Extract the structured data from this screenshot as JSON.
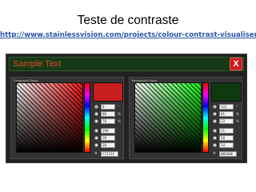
{
  "slide": {
    "title": "Teste de contraste",
    "link": "http://www.stainlessvision.com/projects/colour-contrast-visualiser"
  },
  "app": {
    "sample_text": "Sample Text",
    "close_label": "X",
    "colors": {
      "sample_text": "#e04a2c",
      "sample_bar": "#163a16",
      "close_button": "#cc1a1a",
      "window_background": "#222222",
      "panel_background": "#343434",
      "link": "#2a54a8"
    },
    "foreground_panel": {
      "title": "Foreground Colour",
      "swatch_color": "#c81e1e",
      "hsv": [
        {
          "value": "0",
          "unit": "°"
        },
        {
          "value": "86",
          "unit": "%"
        },
        {
          "value": "78",
          "unit": "%"
        }
      ],
      "rgb": [
        {
          "value": "199"
        },
        {
          "value": "28"
        },
        {
          "value": "28"
        }
      ],
      "hex": "C71C1C",
      "hash": "#"
    },
    "background_panel": {
      "title": "Background Colour",
      "swatch_color": "#0e3a10",
      "hsv": [
        {
          "value": "122",
          "unit": "°"
        },
        {
          "value": "81",
          "unit": "%"
        },
        {
          "value": "23",
          "unit": "%"
        }
      ],
      "rgb": [
        {
          "value": "11"
        },
        {
          "value": "58"
        },
        {
          "value": "14"
        }
      ],
      "hex": "0B3A0E",
      "hash": "#"
    }
  }
}
